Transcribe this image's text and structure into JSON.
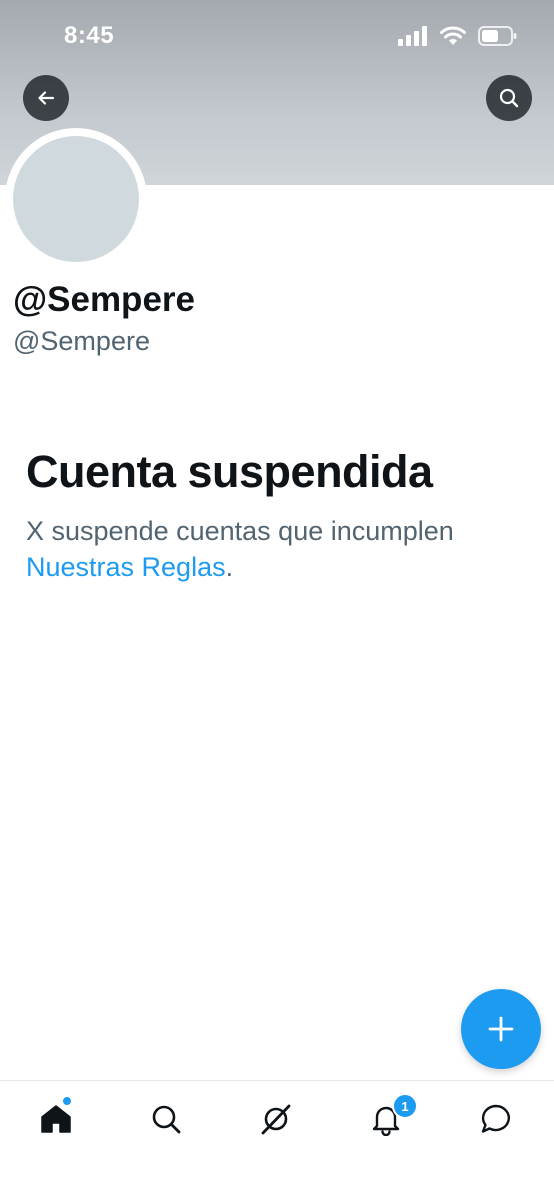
{
  "status_bar": {
    "time": "8:45"
  },
  "profile": {
    "display_name": "@Sempere",
    "handle": "@Sempere"
  },
  "suspension": {
    "title": "Cuenta suspendida",
    "text": "X suspende cuentas que incumplen ",
    "link": "Nuestras Reglas",
    "after_link": "."
  },
  "tabbar": {
    "notifications_badge": "1"
  },
  "colors": {
    "accent": "#1d9bf0",
    "text_primary": "#0f1419",
    "text_secondary": "#536471"
  },
  "icons": {
    "back": "arrow-left-icon",
    "search": "search-icon",
    "compose": "plus-icon",
    "home": "home-icon",
    "explore": "search-icon",
    "grok": "grok-icon",
    "notifications": "bell-icon",
    "messages": "message-icon"
  }
}
